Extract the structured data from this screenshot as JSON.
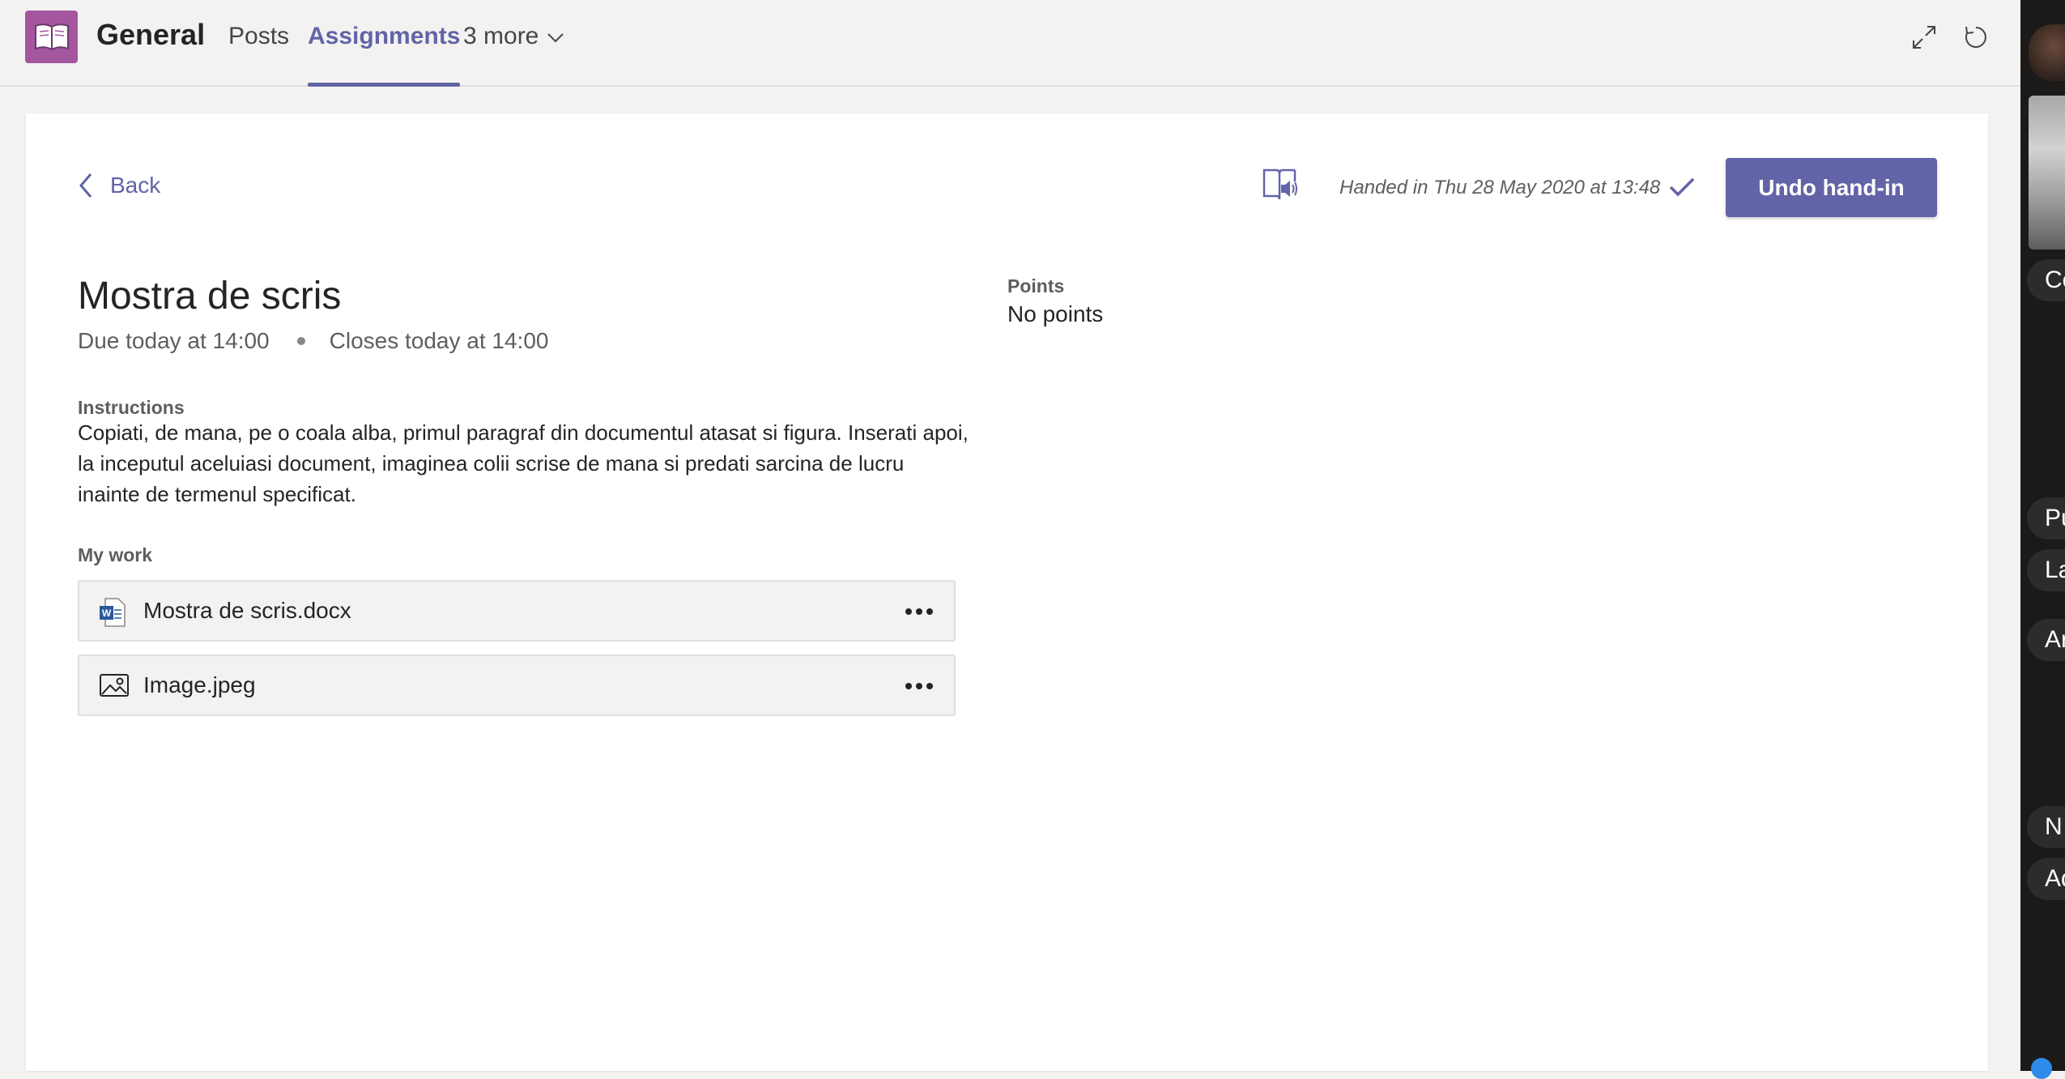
{
  "header": {
    "channel": "General",
    "tabs": [
      {
        "label": "Posts"
      },
      {
        "label": "Assignments"
      }
    ],
    "more": "3 more"
  },
  "assignment": {
    "back": "Back",
    "handed_in": "Handed in Thu 28 May 2020 at 13:48",
    "undo_button": "Undo hand-in",
    "title": "Mostra de scris",
    "due": "Due today at 14:00",
    "closes": "Closes today at 14:00",
    "instructions_label": "Instructions",
    "instructions": "Copiati, de mana, pe o coala alba, primul paragraf din documentul atasat si figura. Inserati apoi, la inceputul aceluiasi document, imaginea colii scrise de mana si predati sarcina de lucru inainte de termenul specificat.",
    "points_label": "Points",
    "points_value": "No points",
    "my_work_label": "My work",
    "files": [
      {
        "name": "Mostra de scris.docx",
        "icon": "word-file-icon"
      },
      {
        "name": "Image.jpeg",
        "icon": "image-file-icon"
      }
    ]
  },
  "side_panel": {
    "pills": [
      "Co",
      "Pu",
      "La",
      "Ar",
      "N",
      "Ad"
    ]
  },
  "colors": {
    "accent": "#6264a7",
    "team_icon": "#a4569f"
  }
}
